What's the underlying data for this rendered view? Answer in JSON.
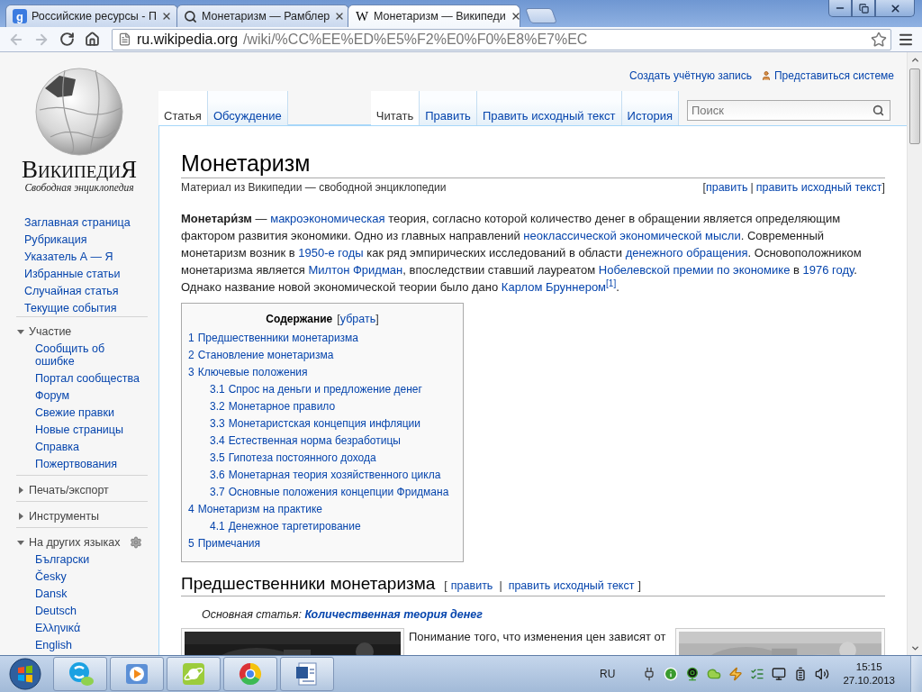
{
  "browser": {
    "tabs": [
      {
        "title": "Российские ресурсы - П",
        "selected": false,
        "icon": {
          "kind": "badge",
          "glyph": "g"
        }
      },
      {
        "title": "Монетаризм — Рамблер",
        "selected": false,
        "icon": {
          "kind": "search"
        }
      },
      {
        "title": "Монетаризм — Википеди",
        "selected": true,
        "icon": {
          "kind": "serif",
          "glyph": "W"
        }
      }
    ],
    "back": {
      "disabled": true
    },
    "forward": {
      "disabled": true
    },
    "address": {
      "host": "ru.wikipedia.org",
      "path": "/wiki/%CC%EE%ED%E5%F2%E0%F0%E8%E7%EC"
    }
  },
  "wiki": {
    "logo": {
      "wordmark": "ВикипедиЯ",
      "tagline": "Свободная энциклопедия"
    },
    "personal": [
      {
        "kind": "link",
        "label": "Создать учётную запись"
      },
      {
        "kind": "user",
        "label": "Представиться системе"
      }
    ],
    "nav": [
      "Заглавная страница",
      "Рубрикация",
      "Указатель А — Я",
      "Избранные статьи",
      "Случайная статья",
      "Текущие события"
    ],
    "portals": [
      {
        "title": "Участие",
        "expanded": true,
        "items": [
          "Сообщить об ошибке",
          "Портал сообщества",
          "Форум",
          "Свежие правки",
          "Новые страницы",
          "Справка",
          "Пожертвования"
        ]
      },
      {
        "title": "Печать/экспорт",
        "expanded": false
      },
      {
        "title": "Инструменты",
        "expanded": false
      },
      {
        "title": "На других языках",
        "expanded": true,
        "settings": true,
        "items": [
          "Български",
          "Česky",
          "Dansk",
          "Deutsch",
          "Ελληνικά",
          "English"
        ]
      }
    ],
    "namespaces": [
      {
        "label": "Статья",
        "selected": true
      },
      {
        "label": "Обсуждение",
        "selected": false
      }
    ],
    "views": [
      {
        "label": "Читать",
        "selected": true
      },
      {
        "label": "Править",
        "selected": false
      },
      {
        "label": "Править исходный текст",
        "selected": false
      },
      {
        "label": "История",
        "selected": false
      }
    ],
    "search": {
      "placeholder": "Поиск"
    },
    "article": {
      "title": "Монетаризм",
      "site_sub": "Материал из Википедии — свободной энциклопедии",
      "edit": {
        "open": "[",
        "links": [
          "править",
          "править исходный текст"
        ],
        "separator": "|",
        "close": "]"
      },
      "lead": [
        {
          "kind": "bold",
          "text": "Монетари́зм"
        },
        {
          "kind": "text",
          "text": " — "
        },
        {
          "kind": "link",
          "text": "макроэкономическая"
        },
        {
          "kind": "text",
          "text": " теория, согласно которой количество денег в обращении является определяющим фактором развития экономики. Одно из главных направлений "
        },
        {
          "kind": "link",
          "text": "неоклассической экономической мысли"
        },
        {
          "kind": "text",
          "text": ". Современный монетаризм возник в "
        },
        {
          "kind": "link",
          "text": "1950-е годы"
        },
        {
          "kind": "text",
          "text": " как ряд эмпирических исследований в области "
        },
        {
          "kind": "link",
          "text": "денежного обращения"
        },
        {
          "kind": "text",
          "text": ". Основоположником монетаризма является "
        },
        {
          "kind": "link",
          "text": "Милтон Фридман"
        },
        {
          "kind": "text",
          "text": ", впоследствии ставший лауреатом "
        },
        {
          "kind": "link",
          "text": "Нобелевской премии по экономике"
        },
        {
          "kind": "text",
          "text": " в "
        },
        {
          "kind": "link",
          "text": "1976 году"
        },
        {
          "kind": "text",
          "text": ". Однако название новой экономической теории было дано "
        },
        {
          "kind": "link",
          "text": "Карлом Бруннером"
        },
        {
          "kind": "ref",
          "text": "[1]"
        },
        {
          "kind": "text",
          "text": "."
        }
      ],
      "toc": {
        "title": "Содержание",
        "toggle": {
          "open": "[",
          "links": [
            "убрать"
          ],
          "close": "]"
        },
        "items": [
          {
            "number": "1",
            "title": "Предшественники монетаризма"
          },
          {
            "number": "2",
            "title": "Становление монетаризма"
          },
          {
            "number": "3",
            "title": "Ключевые положения",
            "children": [
              {
                "number": "3.1",
                "title": "Спрос на деньги и предложение денег"
              },
              {
                "number": "3.2",
                "title": "Монетарное правило"
              },
              {
                "number": "3.3",
                "title": "Монетаристская концепция инфляции"
              },
              {
                "number": "3.4",
                "title": "Естественная норма безработицы"
              },
              {
                "number": "3.5",
                "title": "Гипотеза постоянного дохода"
              },
              {
                "number": "3.6",
                "title": "Монетарная теория хозяйственного цикла"
              },
              {
                "number": "3.7",
                "title": "Основные положения концепции Фридмана"
              }
            ]
          },
          {
            "number": "4",
            "title": "Монетаризм на практике",
            "children": [
              {
                "number": "4.1",
                "title": "Денежное таргетирование"
              }
            ]
          },
          {
            "number": "5",
            "title": "Примечания"
          }
        ]
      },
      "section": {
        "title": "Предшественники монетаризма",
        "edit": {
          "open": "[",
          "links": [
            "править",
            "править исходный текст"
          ],
          "separator": "|",
          "close": "]"
        },
        "hatnote": {
          "label": "Основная статья:",
          "link": "Количественная теория денег"
        },
        "text": "Понимание того, что изменения цен зависят от"
      }
    }
  },
  "taskbar": {
    "apps": [
      {
        "kind": "chat"
      },
      {
        "kind": "media"
      },
      {
        "kind": "planet"
      },
      {
        "kind": "browser"
      },
      {
        "kind": "document"
      }
    ],
    "language": "RU",
    "tray": [
      {
        "kind": "plug"
      },
      {
        "kind": "info"
      },
      {
        "kind": "webcam"
      },
      {
        "kind": "cloud"
      },
      {
        "kind": "lightning"
      },
      {
        "kind": "list"
      },
      {
        "kind": "monitor"
      },
      {
        "kind": "battery"
      },
      {
        "kind": "volume"
      }
    ],
    "time": "15:15",
    "date": "27.10.2013"
  }
}
